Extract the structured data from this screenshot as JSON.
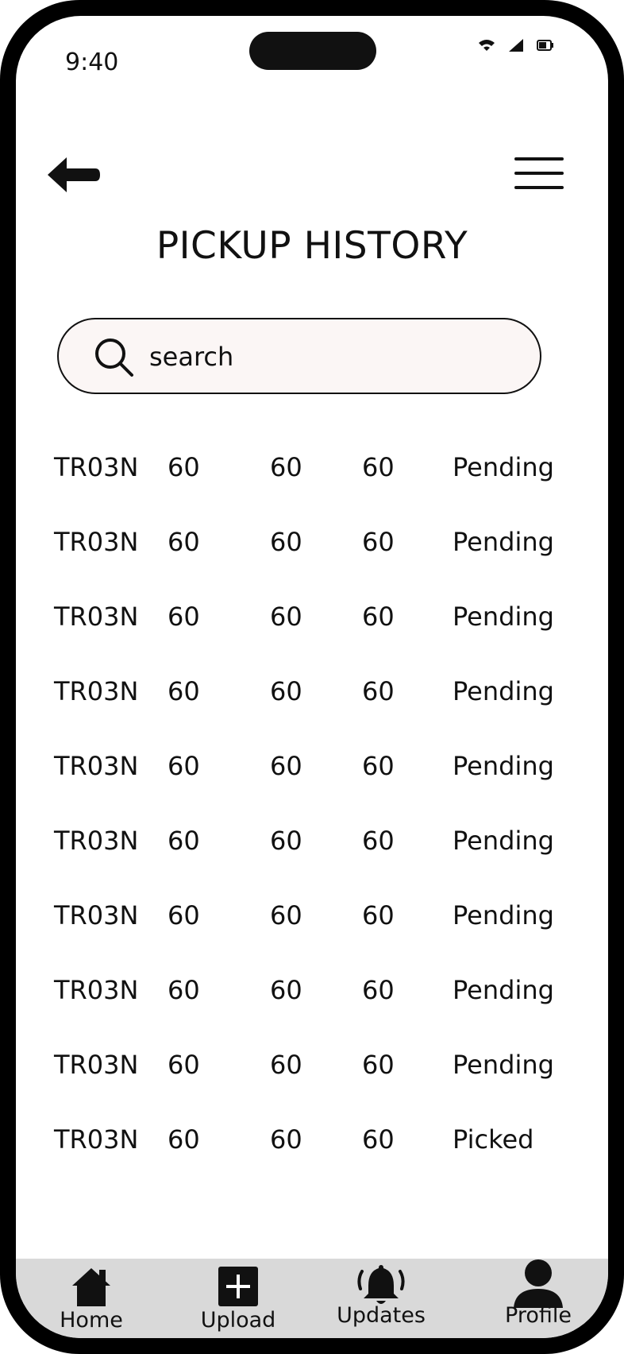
{
  "status_bar": {
    "time": "9:40"
  },
  "header": {
    "title": "PICKUP HISTORY"
  },
  "search": {
    "placeholder": "search"
  },
  "rows": [
    {
      "id": "TR03N",
      "a": "60",
      "b": "60",
      "c": "60",
      "status": "Pending"
    },
    {
      "id": "TR03N",
      "a": "60",
      "b": "60",
      "c": "60",
      "status": "Pending"
    },
    {
      "id": "TR03N",
      "a": "60",
      "b": "60",
      "c": "60",
      "status": "Pending"
    },
    {
      "id": "TR03N",
      "a": "60",
      "b": "60",
      "c": "60",
      "status": "Pending"
    },
    {
      "id": "TR03N",
      "a": "60",
      "b": "60",
      "c": "60",
      "status": "Pending"
    },
    {
      "id": "TR03N",
      "a": "60",
      "b": "60",
      "c": "60",
      "status": "Pending"
    },
    {
      "id": "TR03N",
      "a": "60",
      "b": "60",
      "c": "60",
      "status": "Pending"
    },
    {
      "id": "TR03N",
      "a": "60",
      "b": "60",
      "c": "60",
      "status": "Pending"
    },
    {
      "id": "TR03N",
      "a": "60",
      "b": "60",
      "c": "60",
      "status": "Pending"
    },
    {
      "id": "TR03N",
      "a": "60",
      "b": "60",
      "c": "60",
      "status": "Picked"
    }
  ],
  "tabbar": {
    "home_label": "Home",
    "upload_label": "Upload",
    "updates_label": "Updates",
    "profile_label": "Profile"
  },
  "icons": {
    "back": "arrow-left-icon",
    "menu": "hamburger-menu-icon",
    "search": "search-icon",
    "home": "home-icon",
    "upload": "plus-square-icon",
    "updates": "bell-icon",
    "profile": "user-icon",
    "wifi": "wifi-icon",
    "signal": "signal-icon",
    "battery": "battery-icon"
  },
  "colors": {
    "frame": "#000000",
    "search_bg": "#fbf6f5",
    "tabbar_bg": "#d9d9d9",
    "text": "#111111"
  }
}
